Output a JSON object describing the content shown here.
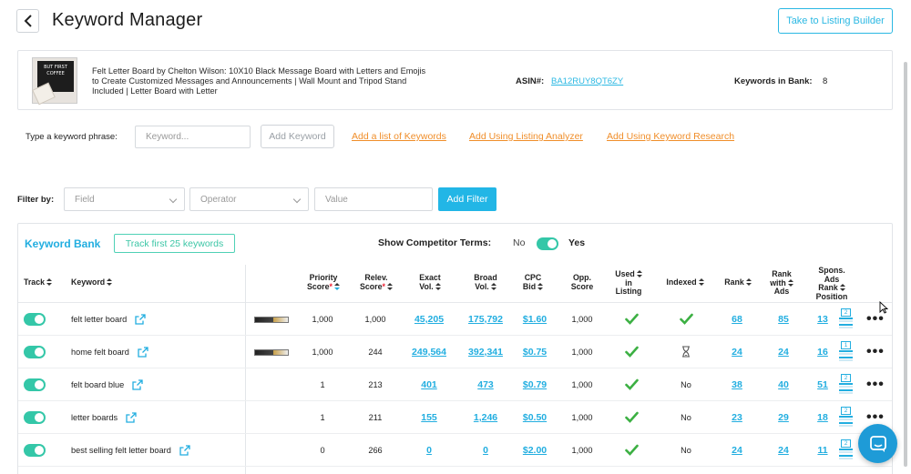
{
  "header": {
    "title": "Keyword Manager",
    "listing_builder_label": "Take to Listing Builder"
  },
  "product": {
    "title": "Felt Letter Board by Chelton Wilson: 10X10 Black Message Board with Letters and Emojis to Create Customized Messages and Announcements | Wall Mount and Tripod Stand Included | Letter Board with Letter",
    "image_text": "BUT FIRST COFFEE",
    "asin_label": "ASIN#:",
    "asin": "BA12RUY8QT6ZY",
    "keywords_in_bank_label": "Keywords in Bank:",
    "keywords_in_bank": "8"
  },
  "add_keyword": {
    "label": "Type a keyword phrase:",
    "placeholder": "Keyword...",
    "button": "Add Keyword",
    "links": [
      "Add a list of Keywords",
      "Add Using Listing Analyzer",
      "Add Using Keyword Research"
    ]
  },
  "filter": {
    "label": "Filter by:",
    "field_placeholder": "Field",
    "operator_placeholder": "Operator",
    "value_placeholder": "Value",
    "button": "Add Filter"
  },
  "bank": {
    "title": "Keyword Bank",
    "track_first_label": "Track first 25 keywords",
    "competitor_label": "Show Competitor Terms:",
    "competitor_no": "No",
    "competitor_yes": "Yes",
    "competitor_on": true
  },
  "columns": {
    "track": "Track",
    "keyword": "Keyword",
    "priority": [
      "Priority",
      "Score"
    ],
    "relev": [
      "Relev.",
      "Score"
    ],
    "exact": [
      "Exact",
      "Vol."
    ],
    "broad": [
      "Broad",
      "Vol."
    ],
    "cpc": [
      "CPC",
      "Bid"
    ],
    "opp": [
      "Opp.",
      "Score"
    ],
    "used": [
      "Used",
      "in",
      "Listing"
    ],
    "indexed": "Indexed",
    "rank": "Rank",
    "rank_ads": [
      "Rank",
      "with",
      "Ads"
    ],
    "spons": [
      "Spons.",
      "Ads",
      "Rank",
      "Position"
    ]
  },
  "rows": [
    {
      "keyword": "felt letter board",
      "comp": true,
      "priority": "1,000",
      "relev": "1,000",
      "exact": "45,205",
      "broad": "175,792",
      "cpc": "$1.60",
      "opp": "1,000",
      "used": "check",
      "indexed": "check",
      "rank": "68",
      "rank_ads": "85",
      "spons": "13",
      "spons_badge": "2"
    },
    {
      "keyword": "home felt board",
      "comp": true,
      "priority": "1,000",
      "relev": "244",
      "exact": "249,564",
      "broad": "392,341",
      "cpc": "$0.75",
      "opp": "1,000",
      "used": "check",
      "indexed": "hourglass",
      "rank": "24",
      "rank_ads": "24",
      "spons": "16",
      "spons_badge": "1"
    },
    {
      "keyword": "felt board blue",
      "comp": false,
      "priority": "1",
      "relev": "213",
      "exact": "401",
      "broad": "473",
      "cpc": "$0.79",
      "opp": "1,000",
      "used": "check",
      "indexed": "No",
      "rank": "38",
      "rank_ads": "40",
      "spons": "51",
      "spons_badge": "2"
    },
    {
      "keyword": "letter boards",
      "comp": false,
      "priority": "1",
      "relev": "211",
      "exact": "155",
      "broad": "1,246",
      "cpc": "$0.50",
      "opp": "1,000",
      "used": "check",
      "indexed": "No",
      "rank": "23",
      "rank_ads": "29",
      "spons": "18",
      "spons_badge": "2"
    },
    {
      "keyword": "best selling felt letter board",
      "comp": false,
      "priority": "0",
      "relev": "266",
      "exact": "0",
      "broad": "0",
      "cpc": "$2.00",
      "opp": "1,000",
      "used": "check",
      "indexed": "No",
      "rank": "24",
      "rank_ads": "24",
      "spons": "11",
      "spons_badge": "2"
    }
  ],
  "colors": {
    "accent": "#22aee0",
    "toggle": "#34c7a8",
    "link_orange": "#f08e2a",
    "check_green": "#3cb043"
  },
  "icons": [
    "back-icon",
    "external-link-icon",
    "check-icon",
    "hourglass-icon",
    "rank-position-icon",
    "more-icon",
    "chat-icon",
    "sort-icon",
    "chevron-down-icon"
  ]
}
